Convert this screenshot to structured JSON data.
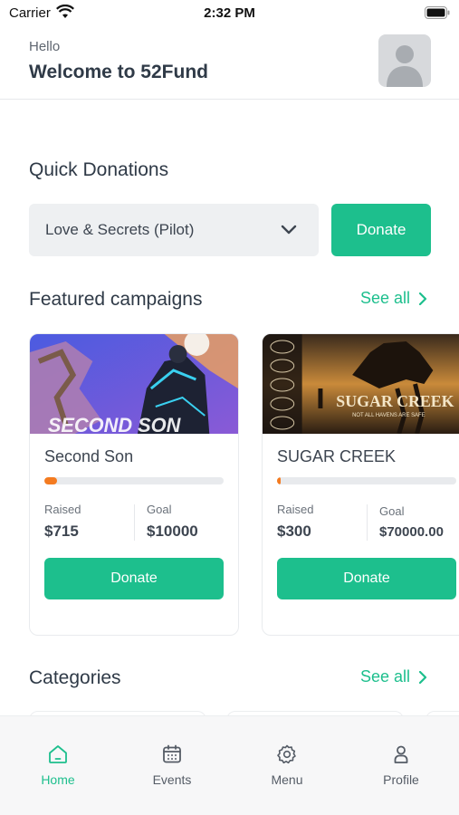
{
  "status_bar": {
    "carrier": "Carrier",
    "time": "2:32 PM"
  },
  "header": {
    "greeting": "Hello",
    "welcome": "Welcome to 52Fund"
  },
  "quick_donations": {
    "title": "Quick Donations",
    "selected_campaign": "Love & Secrets (Pilot)",
    "donate_label": "Donate"
  },
  "featured": {
    "title": "Featured campaigns",
    "see_all": "See all",
    "campaigns": [
      {
        "title": "Second Son",
        "poster_text": "SECOND SON",
        "progress_fraction": 0.07,
        "raised_label": "Raised",
        "raised": "$715",
        "goal_label": "Goal",
        "goal": "$10000",
        "donate_label": "Donate"
      },
      {
        "title": "SUGAR CREEK",
        "poster_text": "SUGAR CREEK",
        "poster_tagline": "NOT ALL HAVENS ARE SAFE",
        "progress_fraction": 0.004,
        "raised_label": "Raised",
        "raised": "$300",
        "goal_label": "Goal",
        "goal": "$70000.00",
        "donate_label": "Donate"
      }
    ]
  },
  "categories": {
    "title": "Categories",
    "see_all": "See all"
  },
  "tabs": [
    {
      "label": "Home",
      "icon": "home-icon",
      "active": true
    },
    {
      "label": "Events",
      "icon": "calendar-icon",
      "active": false
    },
    {
      "label": "Menu",
      "icon": "gear-icon",
      "active": false
    },
    {
      "label": "Profile",
      "icon": "person-icon",
      "active": false
    }
  ],
  "colors": {
    "accent": "#1dbf8d",
    "progress": "#f47b20",
    "text": "#2f3a47"
  }
}
